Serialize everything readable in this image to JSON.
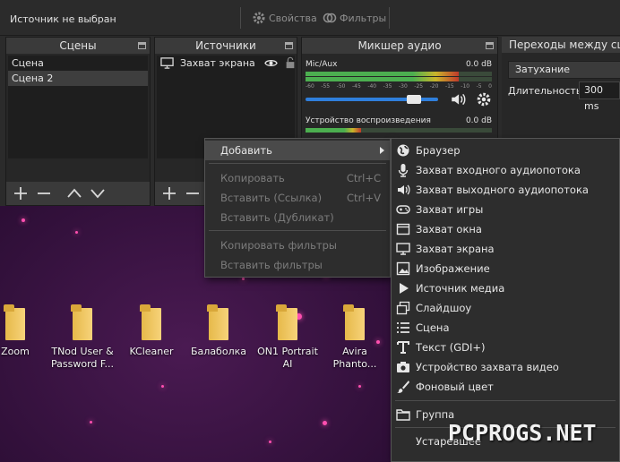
{
  "toolbar": {
    "no_source": "Источник не выбран",
    "properties": "Свойства",
    "filters": "Фильтры"
  },
  "scenes": {
    "title": "Сцены",
    "items": [
      "Сцена",
      "Сцена 2"
    ]
  },
  "sources": {
    "title": "Источники",
    "items": [
      "Захват экрана"
    ]
  },
  "mixer": {
    "title": "Микшер аудио",
    "tracks": [
      {
        "name": "Mic/Aux",
        "level": "0.0 dB"
      },
      {
        "name": "Устройство воспроизведения",
        "level": "0.0 dB"
      }
    ],
    "ticks": [
      "-60",
      "-55",
      "-50",
      "-45",
      "-40",
      "-35",
      "-30",
      "-25",
      "-20",
      "-15",
      "-10",
      "-5",
      "0"
    ],
    "volume": 0.82
  },
  "transitions": {
    "title": "Переходы между сценами",
    "selected": "Затухание",
    "duration_label": "Длительность",
    "duration_value": "300 ms"
  },
  "context_menu": {
    "items": [
      {
        "label": "Добавить",
        "disabled": false,
        "submenu": true
      },
      {
        "label": "Копировать",
        "shortcut": "Ctrl+C",
        "disabled": true
      },
      {
        "label": "Вставить (Ссылка)",
        "shortcut": "Ctrl+V",
        "disabled": true
      },
      {
        "label": "Вставить (Дубликат)",
        "disabled": true
      },
      {
        "label": "Копировать фильтры",
        "disabled": true
      },
      {
        "label": "Вставить фильтры",
        "disabled": true
      }
    ]
  },
  "add_submenu": {
    "items": [
      {
        "label": "Браузер",
        "icon": "globe-icon"
      },
      {
        "label": "Захват входного аудиопотока",
        "icon": "microphone-icon"
      },
      {
        "label": "Захват выходного аудиопотока",
        "icon": "speaker-icon"
      },
      {
        "label": "Захват игры",
        "icon": "gamepad-icon"
      },
      {
        "label": "Захват окна",
        "icon": "window-icon"
      },
      {
        "label": "Захват экрана",
        "icon": "monitor-icon"
      },
      {
        "label": "Изображение",
        "icon": "image-icon"
      },
      {
        "label": "Источник медиа",
        "icon": "play-icon"
      },
      {
        "label": "Слайдшоу",
        "icon": "slideshow-icon"
      },
      {
        "label": "Сцена",
        "icon": "list-icon"
      },
      {
        "label": "Текст (GDI+)",
        "icon": "text-icon"
      },
      {
        "label": "Устройство захвата видео",
        "icon": "camera-icon"
      },
      {
        "label": "Фоновый цвет",
        "icon": "brush-icon"
      },
      {
        "label": "Группа",
        "icon": "folder-icon"
      },
      {
        "label": "Устаревшее",
        "icon": ""
      }
    ]
  },
  "desktop": {
    "icons": [
      "Zoom",
      "TNod User & Password F...",
      "KCleaner",
      "Балаболка",
      "ON1 Portrait AI",
      "Avira Phanto..."
    ]
  },
  "watermark": "PCPROGS.NET",
  "colors": {
    "accent_blue": "#2f7fdc",
    "meter_green": "#4caf50",
    "panel_bg": "#272727",
    "folder_yellow": "#f7d37a"
  }
}
